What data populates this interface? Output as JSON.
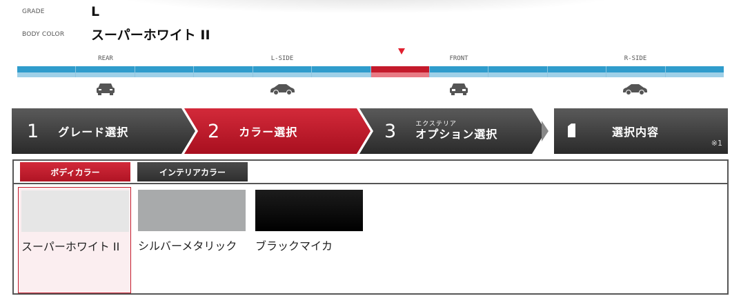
{
  "grade": {
    "label": "GRADE",
    "value": "L"
  },
  "body_color": {
    "label": "BODY COLOR",
    "value": "スーパーホワイト II"
  },
  "views": [
    {
      "label": "REAR",
      "icon": "car-rear-icon"
    },
    {
      "label": "L-SIDE",
      "icon": "car-side-icon"
    },
    {
      "label": "FRONT",
      "icon": "car-front-icon"
    },
    {
      "label": "R-SIDE",
      "icon": "car-side-icon"
    }
  ],
  "view_active_index": 6,
  "colors_ui": {
    "active": "#c41a2b",
    "bar": "#2f9ccc",
    "step_dark": "#3a3a3a"
  },
  "steps": [
    {
      "num": "1",
      "label": "グレード選択"
    },
    {
      "num": "2",
      "label": "カラー選択"
    },
    {
      "num": "3",
      "small": "エクステリア",
      "label": "オプション選択"
    },
    {
      "icon": "document-icon",
      "label": "選択内容",
      "note": "※1"
    }
  ],
  "tabs": {
    "body": "ボディカラー",
    "interior": "インテリアカラー"
  },
  "swatches": [
    {
      "name": "スーパーホワイト II",
      "color": "#e6e6e6",
      "selected": true
    },
    {
      "name": "シルバーメタリック",
      "color": "#a8aaab",
      "selected": false
    },
    {
      "name": "ブラックマイカ",
      "color": "#0a0a0a",
      "selected": false
    }
  ]
}
